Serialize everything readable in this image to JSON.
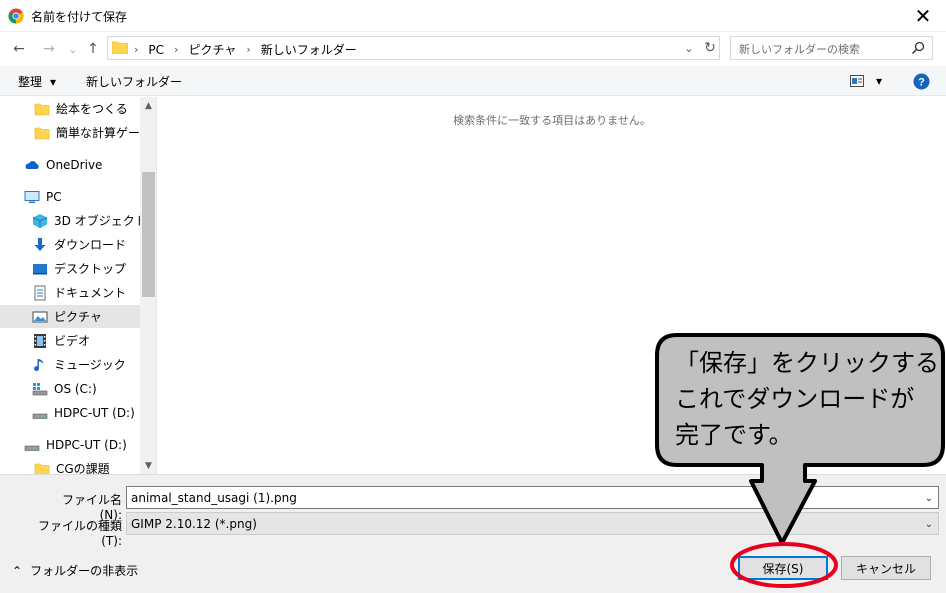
{
  "window": {
    "title": "名前を付けて保存",
    "close_glyph": "✕"
  },
  "nav_buttons": {
    "back": "←",
    "forward": "→",
    "history": "⌄",
    "up": "↑"
  },
  "address": {
    "crumbs": [
      "PC",
      "ピクチャ",
      "新しいフォルダー"
    ],
    "separator": "›",
    "chevron": "⌄",
    "refresh": "↻"
  },
  "search": {
    "placeholder": "新しいフォルダーの検索"
  },
  "toolbar": {
    "organize": "整理",
    "organize_arrow": "▾",
    "new_folder": "新しいフォルダー",
    "view_arrow": "▾"
  },
  "nav": {
    "items": [
      {
        "label": "絵本をつくる",
        "icon": "folder-icon"
      },
      {
        "label": "簡単な計算ゲーム",
        "icon": "folder-icon"
      },
      {
        "label": "OneDrive",
        "icon": "onedrive-icon"
      },
      {
        "label": "PC",
        "icon": "pc-icon"
      },
      {
        "label": "3D オブジェクト",
        "icon": "3d-objects-icon"
      },
      {
        "label": "ダウンロード",
        "icon": "download-icon"
      },
      {
        "label": "デスクトップ",
        "icon": "desktop-icon"
      },
      {
        "label": "ドキュメント",
        "icon": "documents-icon"
      },
      {
        "label": "ピクチャ",
        "icon": "pictures-icon",
        "selected": true
      },
      {
        "label": "ビデオ",
        "icon": "video-icon"
      },
      {
        "label": "ミュージック",
        "icon": "music-icon"
      },
      {
        "label": "OS (C:)",
        "icon": "os-drive-icon"
      },
      {
        "label": "HDPC-UT (D:)",
        "icon": "drive-icon"
      },
      {
        "label": "HDPC-UT (D:)",
        "icon": "drive-icon"
      },
      {
        "label": "CGの課題",
        "icon": "folder-icon"
      }
    ],
    "scroll_up": "▲",
    "scroll_down": "▼"
  },
  "content": {
    "empty_message": "検索条件に一致する項目はありません。"
  },
  "form": {
    "filename_label": "ファイル名(N):",
    "filename_value": "animal_stand_usagi (1).png",
    "filetype_label": "ファイルの種類(T):",
    "filetype_value": "GIMP 2.10.12 (*.png)",
    "chevron": "⌄",
    "hide_folders": "フォルダーの非表示",
    "hide_arrow": "⌃",
    "save": "保存(S)",
    "cancel": "キャンセル"
  },
  "annotation": {
    "callout_lines": [
      "「保存」をクリックする",
      "これでダウンロードが",
      "完了です。"
    ]
  },
  "colors": {
    "accent": "#0078d7",
    "folder": "#ffd54f",
    "callout_fill": "#c0c0c0",
    "callout_border": "#000000",
    "highlight_circle": "#e8001c",
    "selection": "#e5e5e5",
    "help": "#1565c0"
  }
}
